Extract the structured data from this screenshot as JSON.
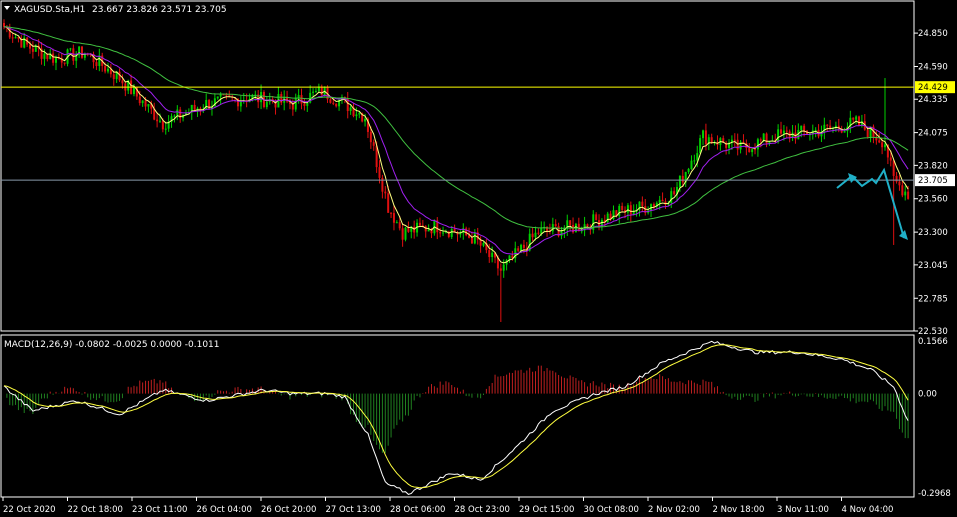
{
  "header": {
    "symbol_label": "XAGUSD.Sta,H1",
    "ohlc_text": "23.667 23.826 23.571 23.705"
  },
  "macd_header": "MACD(12,26,9) -0.0802 -0.0025 0.0000 -0.1011",
  "colors": {
    "background": "#000000",
    "frame": "#ffffff",
    "bull_candle": "#00d000",
    "bear_candle": "#e01010",
    "ma_fast": "#ffff80",
    "ma_mid": "#a020f0",
    "ma_slow": "#40c040",
    "level_line": "#ffff00",
    "price_line": "#8899aa",
    "arrow": "#20b0c8",
    "macd_line": "#ffffff",
    "signal_line": "#ffff40",
    "hist_pos": "#c02020",
    "hist_neg": "#208020"
  },
  "chart_data": [
    {
      "type": "candlestick",
      "title": "XAGUSD.Sta,H1",
      "ylim": [
        22.53,
        25.1
      ],
      "y_ticks": [
        "24.850",
        "24.590",
        "24.335",
        "24.075",
        "23.820",
        "23.560",
        "23.300",
        "23.045",
        "22.785",
        "22.530"
      ],
      "x_ticks": [
        "22 Oct 2020",
        "22 Oct 18:00",
        "23 Oct 11:00",
        "26 Oct 04:00",
        "26 Oct 20:00",
        "27 Oct 13:00",
        "28 Oct 06:00",
        "28 Oct 23:00",
        "29 Oct 15:00",
        "30 Oct 08:00",
        "2 Nov 02:00",
        "2 Nov 18:00",
        "3 Nov 11:00",
        "4 Nov 04:00"
      ],
      "horizontal_level": {
        "value": 24.429,
        "label": "24.429"
      },
      "current_price": {
        "value": 23.705,
        "label": "23.705"
      },
      "close_anchors": [
        [
          0,
          24.9
        ],
        [
          8,
          24.75
        ],
        [
          18,
          24.65
        ],
        [
          28,
          24.7
        ],
        [
          40,
          24.5
        ],
        [
          55,
          24.15
        ],
        [
          70,
          24.3
        ],
        [
          85,
          24.35
        ],
        [
          100,
          24.3
        ],
        [
          110,
          24.4
        ],
        [
          118,
          24.3
        ],
        [
          125,
          24.2
        ],
        [
          133,
          23.5
        ],
        [
          138,
          23.3
        ],
        [
          150,
          23.35
        ],
        [
          163,
          23.25
        ],
        [
          172,
          23.0
        ],
        [
          185,
          23.3
        ],
        [
          200,
          23.35
        ],
        [
          212,
          23.45
        ],
        [
          222,
          23.5
        ],
        [
          232,
          23.6
        ],
        [
          242,
          24.05
        ],
        [
          255,
          23.95
        ],
        [
          268,
          24.05
        ],
        [
          285,
          24.1
        ],
        [
          295,
          24.15
        ],
        [
          305,
          24.0
        ],
        [
          308,
          23.7
        ],
        [
          313,
          23.6
        ]
      ],
      "annotation_arrows": "projected path drawn in cyan"
    },
    {
      "type": "macd",
      "title": "MACD(12,26,9)",
      "values_text": "-0.0802 -0.0025 0.0000 -0.1011",
      "ylim": [
        -0.3,
        0.17
      ],
      "y_ticks": [
        "0.1566",
        "0.00",
        "-0.2968"
      ],
      "macd_anchors": [
        [
          0,
          0.02
        ],
        [
          10,
          -0.05
        ],
        [
          25,
          -0.02
        ],
        [
          40,
          -0.06
        ],
        [
          55,
          0.01
        ],
        [
          70,
          -0.02
        ],
        [
          90,
          0.01
        ],
        [
          100,
          0.0
        ],
        [
          112,
          0.0
        ],
        [
          118,
          -0.01
        ],
        [
          126,
          -0.12
        ],
        [
          132,
          -0.26
        ],
        [
          140,
          -0.29
        ],
        [
          155,
          -0.23
        ],
        [
          165,
          -0.25
        ],
        [
          178,
          -0.15
        ],
        [
          190,
          -0.05
        ],
        [
          205,
          0.0
        ],
        [
          215,
          0.02
        ],
        [
          228,
          0.09
        ],
        [
          245,
          0.15
        ],
        [
          260,
          0.12
        ],
        [
          275,
          0.12
        ],
        [
          290,
          0.1
        ],
        [
          300,
          0.07
        ],
        [
          308,
          0.02
        ],
        [
          313,
          -0.08
        ]
      ]
    }
  ]
}
